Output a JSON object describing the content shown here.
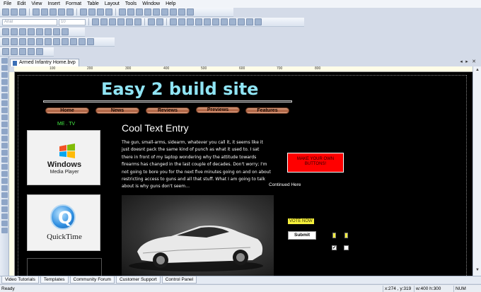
{
  "menu": [
    "File",
    "Edit",
    "View",
    "Insert",
    "Format",
    "Table",
    "Layout",
    "Tools",
    "Window",
    "Help"
  ],
  "toolbar": {
    "font_name": "Arial",
    "font_size": "10"
  },
  "document_tab": {
    "label": "Armed Infantry Home.bvp",
    "nav_prev": "◂",
    "nav_next": "▸",
    "nav_close": "✕"
  },
  "ruler": {
    "numbers": [
      "100",
      "200",
      "300",
      "400",
      "500",
      "600",
      "700",
      "800"
    ]
  },
  "site": {
    "title": "Easy 2 build site",
    "nav": [
      "Home",
      "News",
      "Reviews",
      "Previews",
      "Features"
    ],
    "media_label": "ME . TV",
    "wmp_text_line1": "Windows",
    "wmp_text_line2": "Media Player",
    "qt_letter": "Q",
    "qt_text": "QuickTime",
    "heading": "Cool Text Entry",
    "article": "The gun, small-arms, sidearm, whatever you call it, it seems like it just doesnt pack the same kind of punch as what it used to. I sat there in front of my laptop wondering why the attitude towards firearms has changed in the last couple of decades. Don't worry; I'm not going to bore you for the next five minutes going on and on about restricting access to guns and all that stuff. What I am going to talk about is why guns don't seem…",
    "red_box": "MAKE YOUR OWN BUTTONS!",
    "continued": "Continued Here",
    "vote": "VOTE NOW",
    "submit": "Submit",
    "check_mark": "✔"
  },
  "bottom_tabs": [
    "Video Tutorials",
    "Templates",
    "Community Forum",
    "Customer Support",
    "Control Panel"
  ],
  "status": {
    "left": "Ready",
    "coords": "x:274 , y:319",
    "size": "w:400 h:300",
    "num": "NUM"
  },
  "colors": {
    "title": "#8fe4f4",
    "nav_button": "#b66a48",
    "red_box": "#ff0000",
    "vote_bg": "#f5ef3c",
    "media_label": "#44ee44",
    "canvas_bg": "#000000"
  }
}
